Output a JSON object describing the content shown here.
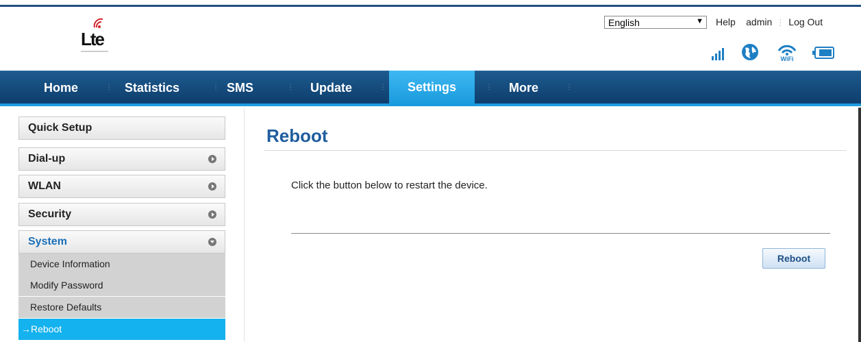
{
  "brand": {
    "logo_text": "Lte"
  },
  "header": {
    "language": "English",
    "help": "Help",
    "user": "admin",
    "logout": "Log Out",
    "status_icons": [
      "signal-strength-icon",
      "globe-icon",
      "wifi-icon",
      "battery-icon"
    ]
  },
  "nav": {
    "items": [
      "Home",
      "Statistics",
      "SMS",
      "Update",
      "Settings",
      "More"
    ],
    "active": "Settings"
  },
  "sidebar": {
    "quick_setup": "Quick Setup",
    "dialup": "Dial-up",
    "wlan": "WLAN",
    "security": "Security",
    "system": "System",
    "sub": [
      "Device Information",
      "Modify Password",
      "Restore Defaults",
      "→Reboot"
    ]
  },
  "main": {
    "title": "Reboot",
    "description": "Click the button below to restart the device.",
    "button": "Reboot"
  },
  "colors": {
    "nav_bg": "#0e3e6d",
    "active_tab": "#1799dc",
    "title": "#1f5d9e",
    "active_sub": "#14b2ee"
  }
}
